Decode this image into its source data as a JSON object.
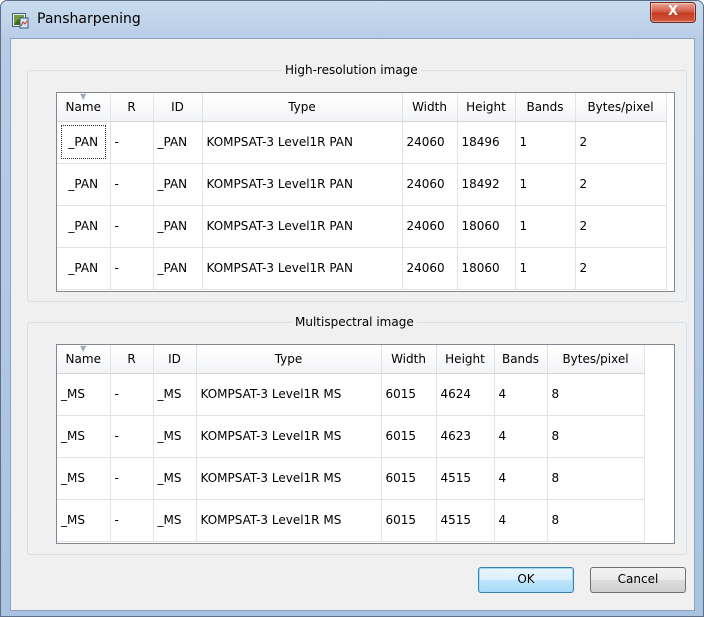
{
  "window": {
    "title": "Pansharpening",
    "close_label": "X"
  },
  "high_res": {
    "group_title": "High-resolution image",
    "columns": [
      "Name",
      "R",
      "ID",
      "Type",
      "Width",
      "Height",
      "Bands",
      "Bytes/pixel"
    ],
    "rows": [
      [
        "_PAN",
        "-",
        "_PAN",
        "KOMPSAT-3 Level1R PAN",
        "24060",
        "18496",
        "1",
        "2"
      ],
      [
        "_PAN",
        "-",
        "_PAN",
        "KOMPSAT-3 Level1R PAN",
        "24060",
        "18492",
        "1",
        "2"
      ],
      [
        "_PAN",
        "-",
        "_PAN",
        "KOMPSAT-3 Level1R PAN",
        "24060",
        "18060",
        "1",
        "2"
      ],
      [
        "_PAN",
        "-",
        "_PAN",
        "KOMPSAT-3 Level1R PAN",
        "24060",
        "18060",
        "1",
        "2"
      ]
    ]
  },
  "multispectral": {
    "group_title": "Multispectral image",
    "columns": [
      "Name",
      "R",
      "ID",
      "Type",
      "Width",
      "Height",
      "Bands",
      "Bytes/pixel"
    ],
    "rows": [
      [
        "_MS",
        "-",
        "_MS",
        "KOMPSAT-3 Level1R MS",
        "6015",
        "4624",
        "4",
        "8"
      ],
      [
        "_MS",
        "-",
        "_MS",
        "KOMPSAT-3 Level1R MS",
        "6015",
        "4623",
        "4",
        "8"
      ],
      [
        "_MS",
        "-",
        "_MS",
        "KOMPSAT-3 Level1R MS",
        "6015",
        "4515",
        "4",
        "8"
      ],
      [
        "_MS",
        "-",
        "_MS",
        "KOMPSAT-3 Level1R MS",
        "6015",
        "4515",
        "4",
        "8"
      ]
    ]
  },
  "buttons": {
    "ok": "OK",
    "cancel": "Cancel"
  }
}
